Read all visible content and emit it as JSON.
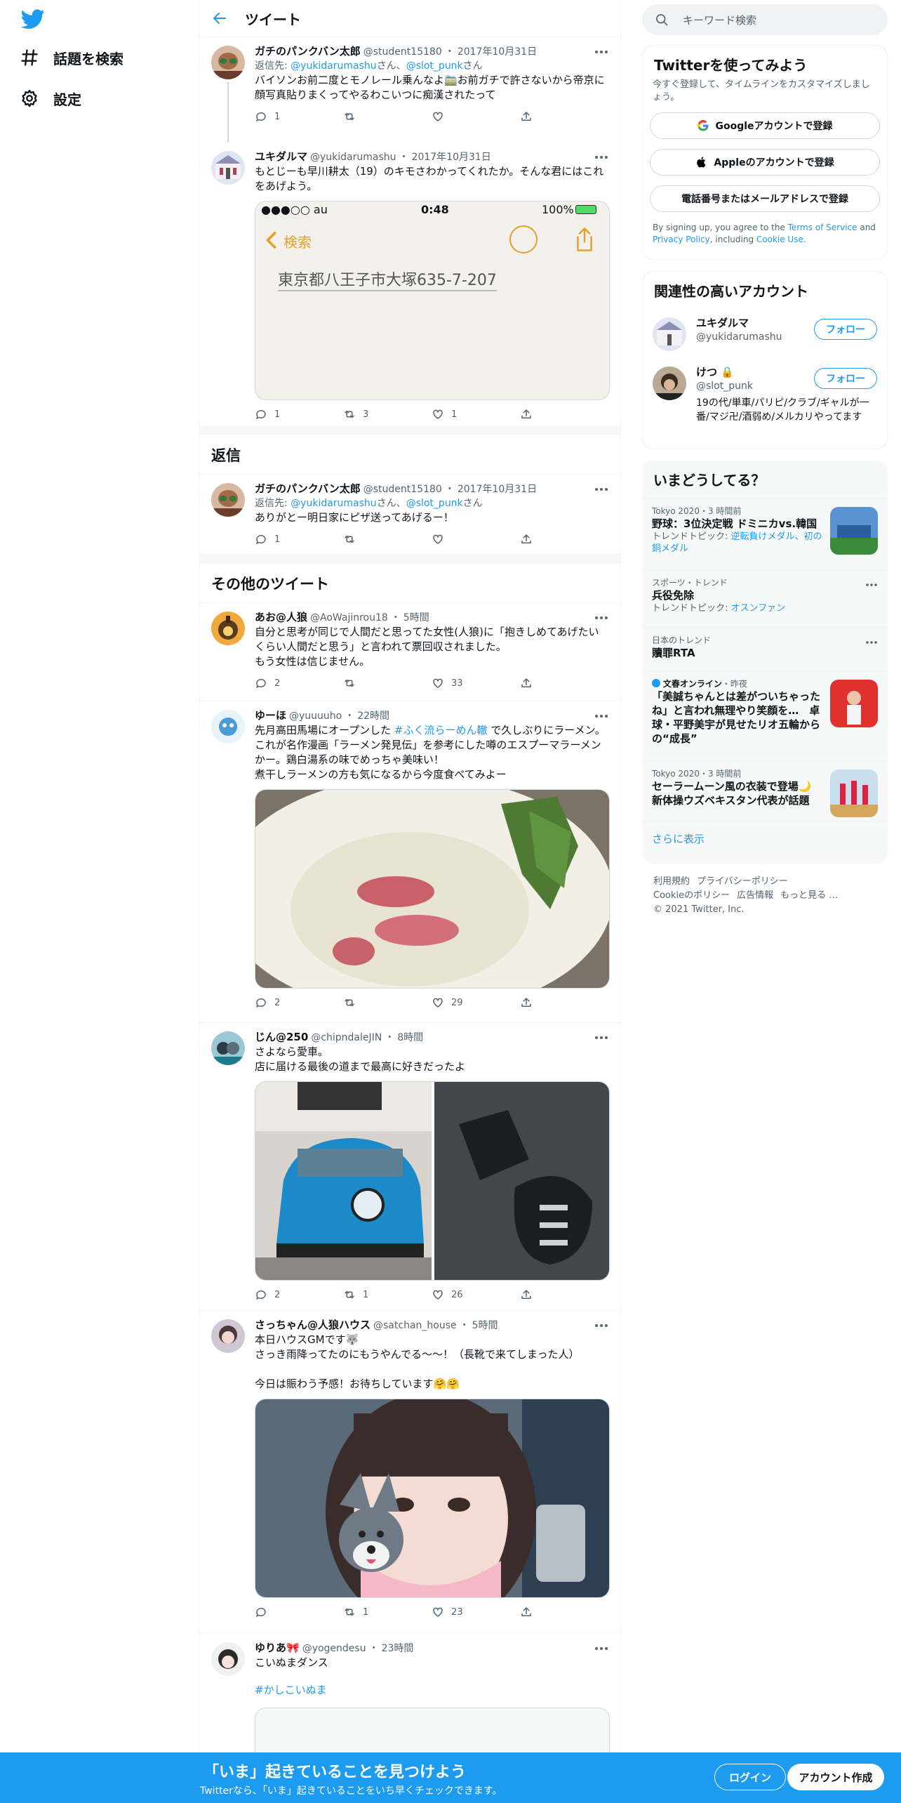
{
  "nav": {
    "explore": "話題を検索",
    "settings": "設定"
  },
  "header": {
    "title": "ツイート"
  },
  "tweets": [
    {
      "name": "ガチのパンクバン太郎",
      "handle": "@student15180",
      "dot": "・",
      "date": "2017年10月31日",
      "reply_prefix": "返信先: ",
      "reply_to1": "@yukidarumashu",
      "reply_sep": "さん、",
      "reply_to2": "@slot_punk",
      "reply_suffix": "さん",
      "text": "バイソンお前二度とモノレール乗んなよ🚞お前ガチで許さないから帝京に顔写真貼りまくってやるわこいつに痴漢されたって",
      "reply_count": "1",
      "retweet_count": "",
      "like_count": ""
    },
    {
      "name": "ユキダルマ",
      "handle": "@yukidarumashu",
      "dot": "・",
      "date": "2017年10月31日",
      "text": "もとじーも早川耕太（19）のキモさわかってくれたか。そんな君にはこれをあげよう。",
      "reply_count": "1",
      "retweet_count": "3",
      "like_count": "1",
      "phone": {
        "carrier": "●●●○○ au",
        "time": "0:48",
        "battery": "100%",
        "back": "検索",
        "note": "東京都八王子市大塚635-7-207"
      }
    }
  ],
  "replies_section": {
    "title": "返信"
  },
  "reply_tweet": {
    "name": "ガチのパンクバン太郎",
    "handle": "@student15180",
    "dot": "・",
    "date": "2017年10月31日",
    "reply_prefix": "返信先: ",
    "reply_to1": "@yukidarumashu",
    "reply_sep": "さん、",
    "reply_to2": "@slot_punk",
    "reply_suffix": "さん",
    "text": "ありがとー明日家にピザ送ってあげるー！",
    "reply_count": "1",
    "retweet_count": "",
    "like_count": ""
  },
  "other_section": {
    "title": "その他のツイート"
  },
  "other_tweets": [
    {
      "name": "あお@人狼",
      "handle": "@AoWajinrou18",
      "dot": "・",
      "date": "5時間",
      "text": "自分と思考が同じで人間だと思ってた女性(人狼)に「抱きしめてあげたいくらい人間だと思う」と言われて票回収されました。\nもう女性は信じません。",
      "reply_count": "2",
      "retweet_count": "",
      "like_count": "33"
    },
    {
      "name": "ゆーほ",
      "handle": "@yuuuuho",
      "dot": "・",
      "date": "22時間",
      "text_pre": "先月高田馬場にオープンした ",
      "hashtag": "#ふく流らーめん轍",
      "text_post": " で久しぶりにラーメン。\nこれが名作漫画「ラーメン発見伝」を参考にした噂のエスプーマラーメンかー。鶏白湯系の味でめっちゃ美味い！\n煮干しラーメンの方も気になるから今度食べてみよー",
      "reply_count": "2",
      "retweet_count": "",
      "like_count": "29"
    },
    {
      "name": "じん@250",
      "handle": "@chipndaleJIN",
      "dot": "・",
      "date": "8時間",
      "text": "さよなら愛車。\n店に届ける最後の道まで最高に好きだったよ",
      "reply_count": "2",
      "retweet_count": "1",
      "like_count": "26"
    },
    {
      "name": "さっちゃん@人狼ハウス",
      "handle": "@satchan_house",
      "dot": "・",
      "date": "5時間",
      "text": "本日ハウスGMです🐺\nさっき雨降ってたのにもうやんでる～～！（長靴で来てしまった人）\n\n今日は賑わう予感！お待ちしています🤗🤗",
      "reply_count": "",
      "retweet_count": "1",
      "like_count": "23"
    },
    {
      "name": "ゆりあ🎀",
      "handle": "@yogendesu",
      "dot": "・",
      "date": "23時間",
      "text": "こいぬまダンス",
      "hashtag": "#かしこいぬま"
    }
  ],
  "sidebar": {
    "search_placeholder": "キーワード検索",
    "signup": {
      "title": "Twitterを使ってみよう",
      "subtitle": "今すぐ登録して、タイムラインをカスタマイズしましょう。",
      "google": "Googleアカウントで登録",
      "apple": "Appleのアカウントで登録",
      "phone": "電話番号またはメールアドレスで登録",
      "terms_pre": "By signing up, you agree to the ",
      "terms_link": "Terms of Service",
      "terms_and": " and ",
      "privacy_link": "Privacy Policy",
      "terms_incl": ", including ",
      "cookie_link": "Cookie Use",
      "terms_end": "."
    },
    "related": {
      "title": "関連性の高いアカウント",
      "follow": "フォロー",
      "accounts": [
        {
          "name": "ユキダルマ",
          "handle": "@yukidarumashu",
          "bio": ""
        },
        {
          "name": "けつ 🔒",
          "handle": "@slot_punk",
          "bio": "19の代/単車/パリピ/クラブ/ギャルが一番/マジ卍/酒弱め/メルカリやってます"
        }
      ]
    },
    "trends": {
      "title": "いまどうしてる？",
      "items": [
        {
          "meta": "Tokyo 2020・3 時間前",
          "title": "野球：3位決定戦 ドミニカvs.韓国",
          "topic_label": "トレンドトピック: ",
          "topic": "逆転負けメダル、初の銅メダル"
        },
        {
          "meta": "スポーツ・トレンド",
          "title": "兵役免除",
          "topic_label": "トレンドトピック: ",
          "topic": "オスンファン"
        },
        {
          "meta": "日本のトレンド",
          "title": "贖罪RTA"
        },
        {
          "meta_name": "文春オンライン",
          "meta_time": "・昨夜",
          "title": "「美誠ちゃんとは差がついちゃったね」と言われ無理やり笑顔を…　卓球・平野美宇が見せたリオ五輪からの“成長”"
        },
        {
          "meta": "Tokyo 2020・3 時間前",
          "title": "セーラームーン風の衣装で登場🌙新体操ウズベキスタン代表が話題"
        }
      ],
      "show_more": "さらに表示"
    },
    "footer": {
      "l1": [
        "利用規約",
        "プライバシーポリシー"
      ],
      "l2": [
        "Cookieのポリシー",
        "広告情報",
        "もっと見る …"
      ],
      "copy": "© 2021 Twitter, Inc."
    }
  },
  "bottom_bar": {
    "title": "「いま」起きていることを見つけよう",
    "subtitle": "Twitterなら、「いま」起きていることをいち早くチェックできます。",
    "login": "ログイン",
    "signup": "アカウント作成"
  },
  "colors": {
    "accent": "#1d9bf0",
    "text": "#0f1419",
    "muted": "#536471",
    "border": "#eff3f4"
  }
}
